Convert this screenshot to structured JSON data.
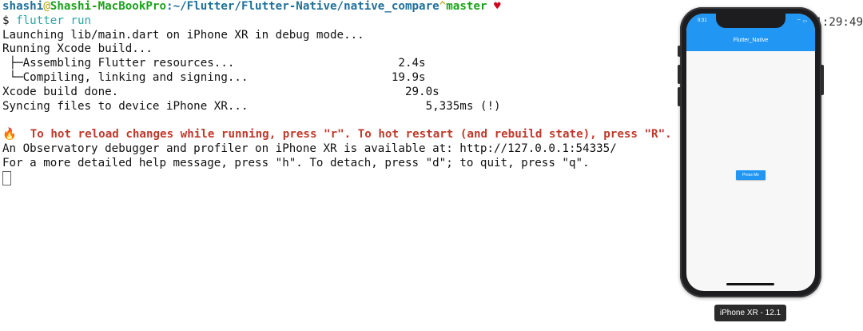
{
  "terminal": {
    "prompt": {
      "user": "shashi",
      "at": "@",
      "host": "Shashi-MacBookPro",
      "colon": ":",
      "path": "~/Flutter/Flutter-Native/native_compare",
      "caret": "^",
      "branch": "master",
      "heart": "♥"
    },
    "command_prefix": "$",
    "command": "flutter run",
    "clock": "1:29:49",
    "lines": {
      "launching": "Launching lib/main.dart on iPhone XR in debug mode...",
      "running_xcode": "Running Xcode build...",
      "assembling": " ├─Assembling Flutter resources...                        2.4s",
      "compiling": " └─Compiling, linking and signing...                     19.9s",
      "xcode_done": "Xcode build done.                                          29.0s",
      "syncing": "Syncing files to device iPhone XR...                          5,335ms (!)",
      "hot_reload_icon": "🔥",
      "hot_reload": "  To hot reload changes while running, press \"r\". To hot restart (and rebuild state), press \"R\".",
      "observatory": "An Observatory debugger and profiler on iPhone XR is available at: http://127.0.0.1:54335/",
      "help": "For a more detailed help message, press \"h\". To detach, press \"d\"; to quit, press \"q\"."
    }
  },
  "simulator": {
    "status_time": "9:31",
    "status_icons": "⌔ ▭",
    "app_title": "Flutter_Native",
    "button_label": "Press Me",
    "device_label": "iPhone XR - 12.1"
  },
  "colors": {
    "app_bar": "#2196f3",
    "warning_text": "#c0392b",
    "prompt_user": "#1f6f9a",
    "prompt_host": "#1aa31a"
  }
}
